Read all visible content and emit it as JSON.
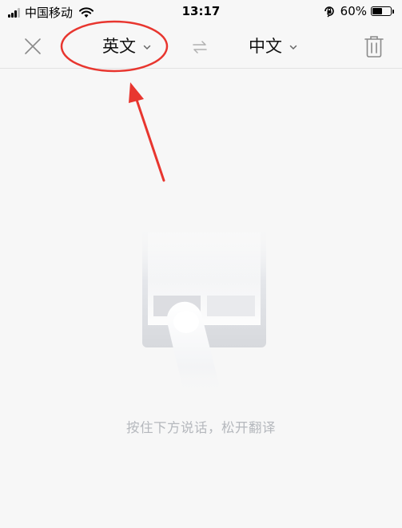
{
  "status_bar": {
    "carrier": "中国移动",
    "time": "13:17",
    "battery_percent": "60%",
    "battery_level": 0.6,
    "icons": [
      "signal-icon",
      "wifi-icon",
      "orientation-lock-icon",
      "battery-icon"
    ]
  },
  "toolbar": {
    "source_language": "英文",
    "target_language": "中文",
    "icons": [
      "close-icon",
      "chevron-down-icon",
      "swap-arrows-icon",
      "trash-icon"
    ]
  },
  "main": {
    "hint": "按住下方说话，松开翻译"
  },
  "annotation": {
    "color": "#e8362f",
    "shapes": [
      "ellipse",
      "arrow"
    ]
  },
  "colors": {
    "background": "#f7f7f7",
    "hint_text": "#b5b8bd",
    "icon_gray": "#8a8a8a"
  }
}
